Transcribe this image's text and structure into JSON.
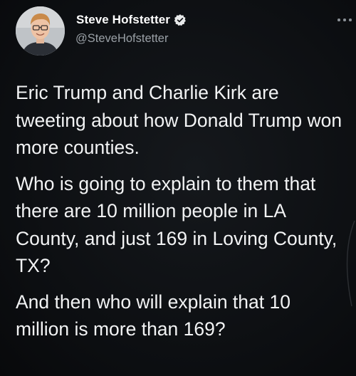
{
  "author": {
    "display_name": "Steve Hofstetter",
    "handle": "@SteveHofstetter",
    "verified": true,
    "verified_color": "#e7e9ea"
  },
  "tweet": {
    "paragraphs": [
      "Eric Trump and Charlie Kirk are tweeting about how Donald Trump won more counties.",
      "Who is going to explain to them that there are 10 million people in LA County, and just 169 in Loving County, TX?",
      "And then who will explain that 10 million is more than 169?"
    ]
  },
  "icons": {
    "more": "more-options-icon",
    "verified": "verified-badge-icon",
    "avatar": "profile-photo"
  },
  "colors": {
    "background": "#0b0d10",
    "text": "#f2f3f4",
    "handle": "#9aa0a6"
  }
}
